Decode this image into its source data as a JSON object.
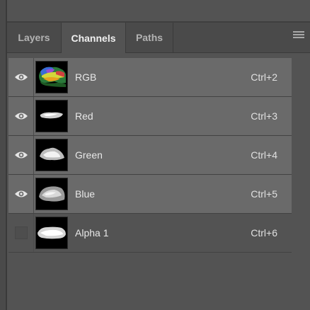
{
  "tabs": [
    {
      "label": "Layers",
      "active": false
    },
    {
      "label": "Channels",
      "active": true
    },
    {
      "label": "Paths",
      "active": false
    }
  ],
  "panel_menu_icon": "hamburger-menu-icon",
  "channels": [
    {
      "name": "RGB",
      "shortcut": "Ctrl+2",
      "visible": true,
      "thumb": "rgb"
    },
    {
      "name": "Red",
      "shortcut": "Ctrl+3",
      "visible": true,
      "thumb": "gray"
    },
    {
      "name": "Green",
      "shortcut": "Ctrl+4",
      "visible": true,
      "thumb": "gray"
    },
    {
      "name": "Blue",
      "shortcut": "Ctrl+5",
      "visible": true,
      "thumb": "gray"
    },
    {
      "name": "Alpha 1",
      "shortcut": "Ctrl+6",
      "visible": false,
      "thumb": "gray"
    }
  ],
  "colors": {
    "panel_bg": "#535353",
    "row_selected_bg": "#6a6a6a",
    "tab_bar_bg": "#4a4a4a",
    "text": "#e8e8e8"
  }
}
